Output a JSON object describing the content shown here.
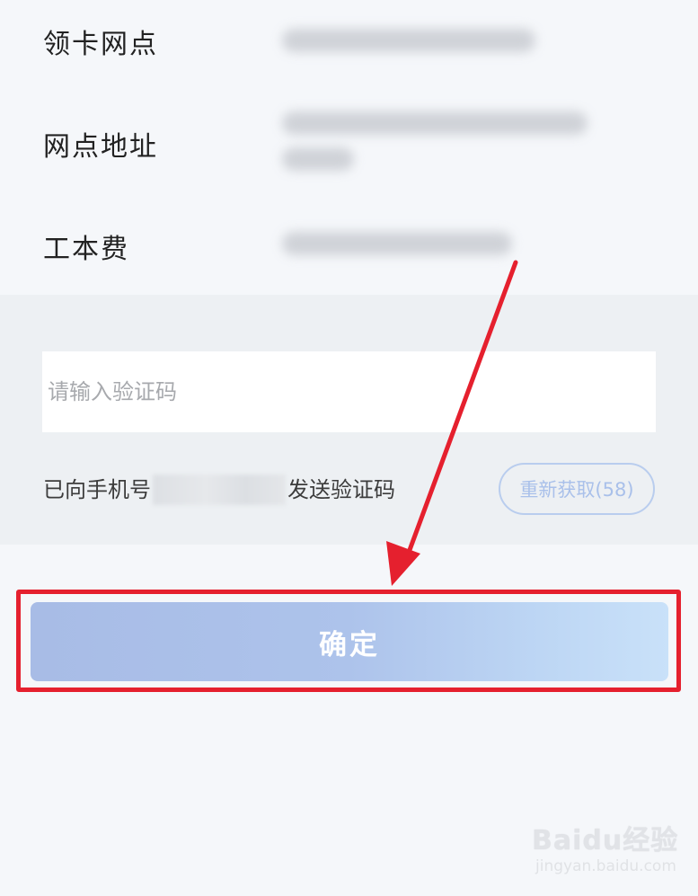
{
  "info": {
    "items": [
      {
        "label": "领卡网点"
      },
      {
        "label": "网点地址"
      },
      {
        "label": "工本费"
      }
    ]
  },
  "verify": {
    "code_placeholder": "请输入验证码",
    "code_value": "",
    "hint_prefix": "已向手机号",
    "hint_suffix": "发送验证码",
    "resend_label": "重新获取(58)"
  },
  "confirm_label": "确定",
  "colors": {
    "highlight": "#e5202e",
    "arrow": "#e5202e",
    "confirm_gradient_start": "#a8bce6",
    "confirm_gradient_end": "#c9e1f9",
    "resend_border": "#b9cdee"
  },
  "watermark": {
    "logo": "Baidu经验",
    "url": "jingyan.baidu.com"
  }
}
